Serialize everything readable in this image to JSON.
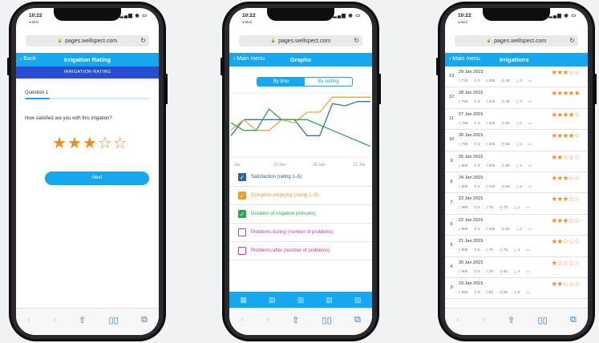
{
  "status": {
    "time": "10:22",
    "back_app": "◂ Mail"
  },
  "browser": {
    "url": "pages.wellspect.com"
  },
  "screen1": {
    "back": "Back",
    "title": "Irrigation Rating",
    "subheader": "IRRIGATION RATING",
    "question_label": "Question 1",
    "progress": 0.2,
    "question": "How satisfied are you with this irrigation?",
    "rating": 3,
    "rating_max": 5,
    "next_button": "Next"
  },
  "screen2": {
    "back": "Main menu",
    "title": "Graphs",
    "seg_by_time": "By time",
    "seg_by_setting": "By setting",
    "chart_data": {
      "type": "line",
      "x": [
        "Jan",
        "23 Jan",
        "26 Jan",
        "21 Jan"
      ],
      "x_tick_labels": [
        "Jan",
        "23 Jan",
        "26 Jan",
        "21 Jan"
      ],
      "ylim": [
        0,
        6
      ],
      "series": [
        {
          "name": "Satisfaction (rating 1-5)",
          "color": "#3d6bb5",
          "values": [
            2,
            3.5,
            3.5,
            3.5,
            3.5,
            3.5,
            2,
            2,
            5,
            4.8,
            5.2,
            5.2
          ]
        },
        {
          "name": "Complete emptying (rating 1-5)",
          "color": "#f3a33c",
          "values": [
            2.5,
            3.5,
            2.5,
            2.5,
            3.5,
            3.2,
            4.2,
            4.2,
            5.6,
            5.6,
            5.6,
            5.6
          ]
        },
        {
          "name": "Duration of irrigation (minutes)",
          "color": "#2ea84a",
          "values": [
            3.2,
            2.5,
            2.5,
            4.5,
            3.5,
            3.5,
            3.5,
            3,
            2.5,
            2,
            1.5,
            1
          ]
        }
      ]
    },
    "legend": [
      {
        "label": "Satisfaction (rating 1–5)",
        "color": "#2f5fb0",
        "checked": true
      },
      {
        "label": "Complete emptying (rating 1–5)",
        "color": "#f39a2a",
        "checked": true
      },
      {
        "label": "Duration of irrigation (minutes)",
        "color": "#2ea84a",
        "checked": true
      },
      {
        "label": "Problems during (number of problems)",
        "color": "#a14bc4",
        "checked": false
      },
      {
        "label": "Problems after (number of problems)",
        "color": "#e0358f",
        "checked": false
      }
    ]
  },
  "screen3": {
    "back": "Main menu",
    "title": "Irrigations",
    "rows": [
      {
        "num": "13",
        "date": "29 Jan 2015",
        "stars": 3,
        "vol": "775",
        "p": "3",
        "t": "255",
        "d": "40",
        "a": "0"
      },
      {
        "num": "12",
        "date": "28 Jan 2015",
        "stars": 5,
        "vol": "750",
        "p": "4",
        "t": "215",
        "d": "45",
        "a": "0"
      },
      {
        "num": "11",
        "date": "27 Jan 2015",
        "stars": 4,
        "vol": "750",
        "p": "4",
        "t": "235",
        "d": "60",
        "a": "0"
      },
      {
        "num": "10",
        "date": "26 Jan 2015",
        "stars": 4,
        "vol": "750",
        "p": "4",
        "t": "225",
        "d": "55",
        "a": "0"
      },
      {
        "num": "9",
        "date": "25 Jan 2015",
        "stars": 2,
        "vol": "800",
        "p": "3",
        "t": "200",
        "d": "80",
        "a": "4"
      },
      {
        "num": "8",
        "date": "24 Jan 2015",
        "stars": 3,
        "vol": "800",
        "p": "4",
        "t": "150",
        "d": "65",
        "a": "3"
      },
      {
        "num": "7",
        "date": "23 Jan 2015",
        "stars": 3,
        "vol": "600",
        "p": "4",
        "t": "75",
        "d": "75",
        "a": "1"
      },
      {
        "num": "6",
        "date": "22 Jan 2015",
        "stars": 3,
        "vol": "800",
        "p": "4",
        "t": "100",
        "d": "60",
        "a": "3"
      },
      {
        "num": "5",
        "date": "21 Jan 2015",
        "stars": 2,
        "vol": "800",
        "p": "5",
        "t": "75",
        "d": "75",
        "a": "4"
      },
      {
        "num": "4",
        "date": "20 Jan 2015",
        "stars": 1,
        "vol": "800",
        "p": "4",
        "t": "70",
        "d": "60",
        "a": "4"
      },
      {
        "num": "3",
        "date": "19 Jan 2015",
        "stars": 2,
        "vol": "500",
        "p": "3",
        "t": "60",
        "d": "85",
        "a": "5"
      }
    ]
  }
}
